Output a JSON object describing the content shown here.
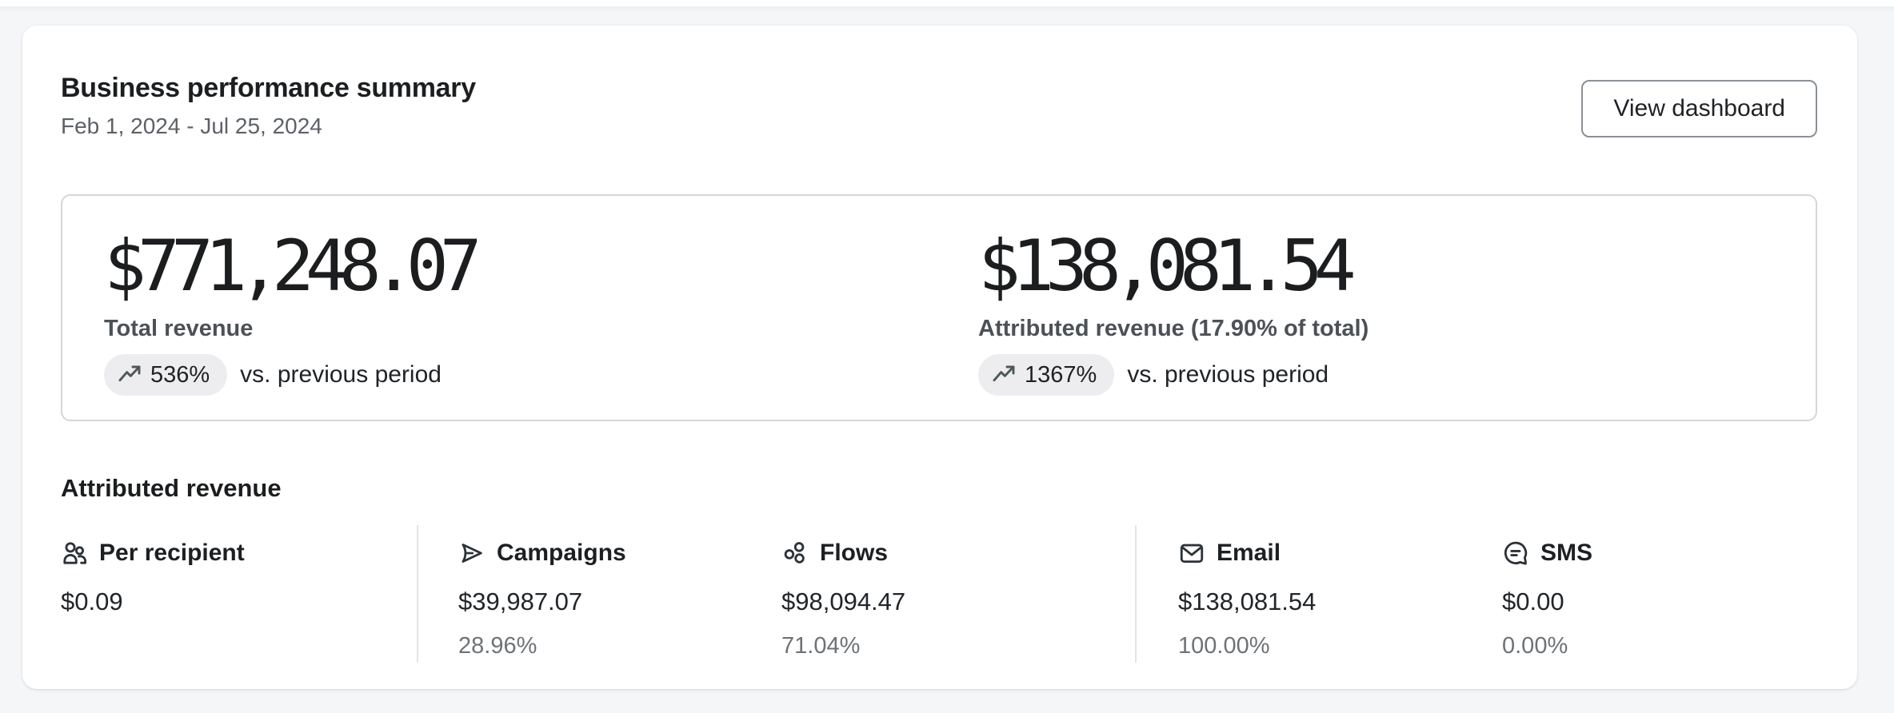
{
  "header": {
    "title": "Business performance summary",
    "date_range": "Feb 1, 2024 - Jul 25, 2024",
    "view_dashboard_label": "View dashboard"
  },
  "metrics": [
    {
      "amount": "$771,248.07",
      "label": "Total revenue",
      "change": "536%",
      "comparison": "vs. previous period",
      "trend_icon": "trending-up-icon"
    },
    {
      "amount": "$138,081.54",
      "label": "Attributed revenue (17.90% of total)",
      "change": "1367%",
      "comparison": "vs. previous period",
      "trend_icon": "trending-up-icon"
    }
  ],
  "attributed_revenue": {
    "heading": "Attributed revenue",
    "columns": [
      {
        "icon": "people-icon",
        "label": "Per recipient",
        "value": "$0.09",
        "percent": ""
      },
      {
        "icon": "send-icon",
        "label": "Campaigns",
        "value": "$39,987.07",
        "percent": "28.96%"
      },
      {
        "icon": "flows-icon",
        "label": "Flows",
        "value": "$98,094.47",
        "percent": "71.04%"
      },
      {
        "icon": "email-icon",
        "label": "Email",
        "value": "$138,081.54",
        "percent": "100.00%"
      },
      {
        "icon": "sms-icon",
        "label": "SMS",
        "value": "$0.00",
        "percent": "0.00%"
      }
    ]
  },
  "colors": {
    "page_background": "#f5f6f8",
    "card_background": "#ffffff",
    "badge_background": "#ededef",
    "badge_icon": "#4d5a53",
    "muted_text": "#6e7277",
    "border": "#d3d6da",
    "divider": "#e3e5e8"
  }
}
